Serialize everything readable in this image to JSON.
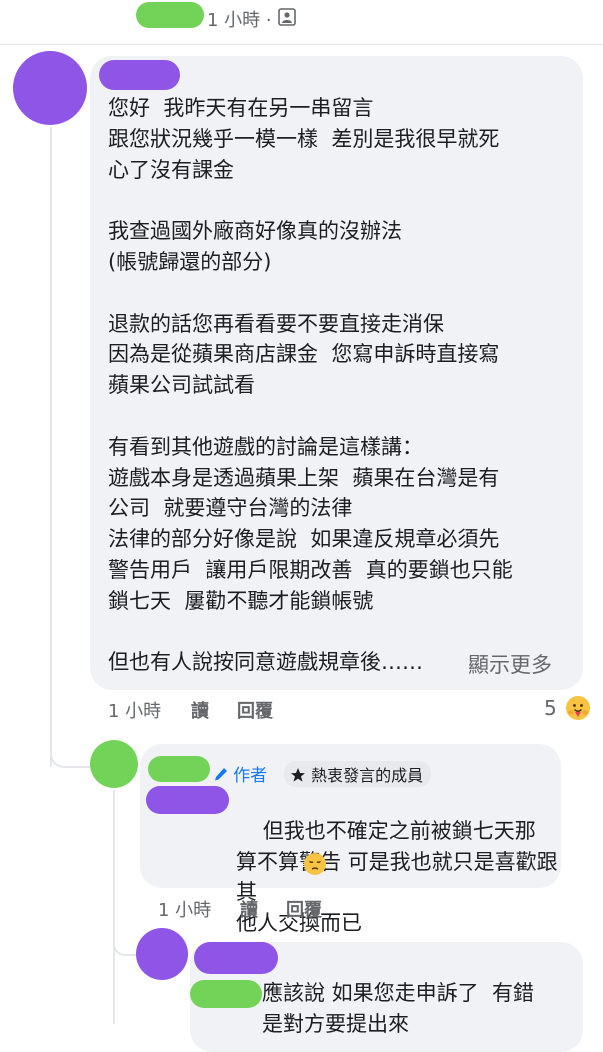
{
  "top": {
    "time": "1 小時",
    "sep": "·",
    "audience_icon": "friends-icon"
  },
  "comment1": {
    "lines": "您好  我昨天有在另一串留言\n跟您狀況幾乎一模一樣  差別是我很早就死\n心了沒有課金\n\n我查過國外廠商好像真的沒辦法\n(帳號歸還的部分)\n\n退款的話您再看看要不要直接走消保\n因為是從蘋果商店課金  您寫申訴時直接寫\n蘋果公司試試看\n\n有看到其他遊戲的討論是這樣講：\n遊戲本身是透過蘋果上架  蘋果在台灣是有\n公司  就要遵守台灣的法律\n法律的部分好像是說  如果違反規章必須先\n警告用戶  讓用戶限期改善  真的要鎖也只能\n鎖七天  屢勸不聽才能鎖帳號\n\n但也有人說按同意遊戲規章後……",
    "see_more": "顯示更多",
    "time": "1 小時",
    "read": "讀",
    "reply": "回覆",
    "reaction_count": "5",
    "reaction_icon": "care-reaction-icon"
  },
  "comment2": {
    "author_badge": "作者",
    "author_icon": "pencil-icon",
    "member_badge": "熱衷發言的成員",
    "member_icon": "star-icon",
    "lines": "但我也不確定之前被鎖七天那\n算不算警告 可是我也就只是喜歡跟其\n他人交換而已",
    "emoji": "pensive-face-icon",
    "time": "1 小時",
    "read": "讀",
    "reply": "回覆"
  },
  "comment3": {
    "lines": "應該說 如果您走申訴了  有錯\n是對方要提出來"
  },
  "colors": {
    "redaction_green": "#73d358",
    "redaction_purple": "#8f55e6",
    "bubble": "#f0f2f5",
    "link_blue": "#1877f2"
  }
}
